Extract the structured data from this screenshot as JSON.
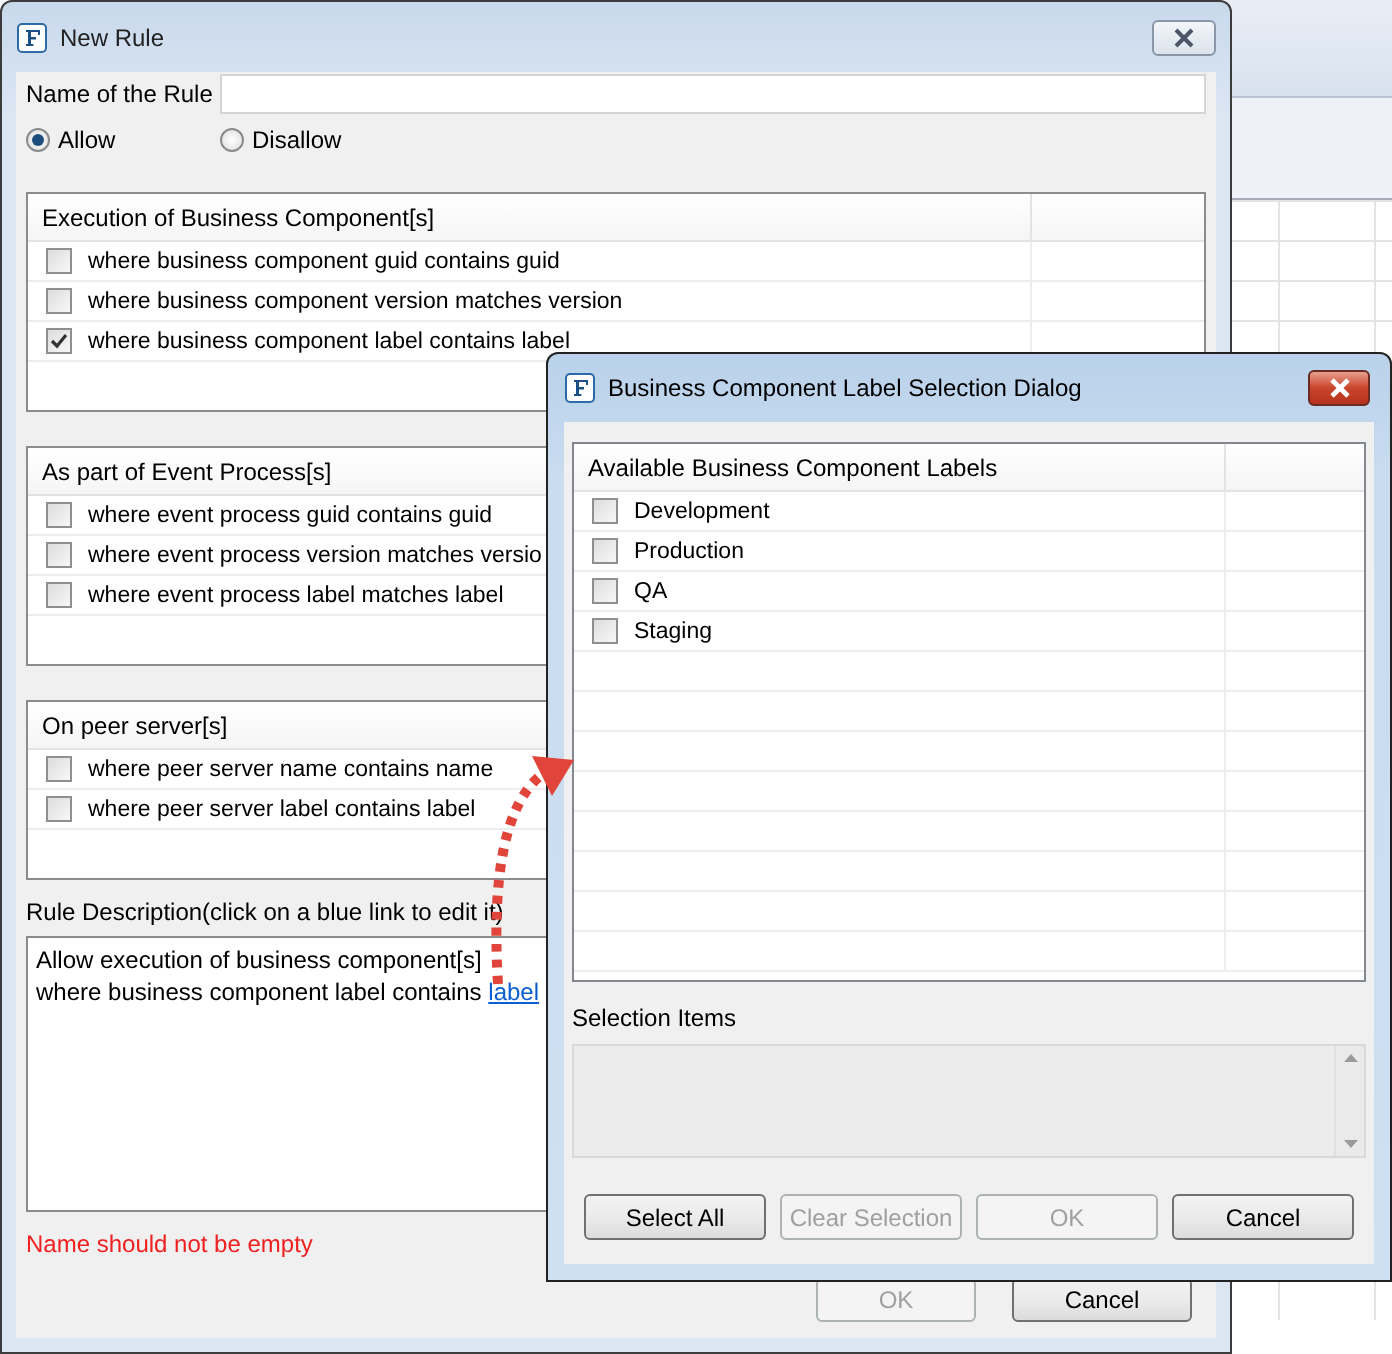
{
  "main_window": {
    "title": "New Rule",
    "name_label": "Name of the Rule",
    "radios": [
      {
        "label": "Allow",
        "selected": true
      },
      {
        "label": "Disallow",
        "selected": false
      }
    ],
    "groups": [
      {
        "title": "Execution of Business Component[s]",
        "conditions": [
          {
            "text": "where business component guid contains guid",
            "checked": false
          },
          {
            "text": "where business component version matches version",
            "checked": false
          },
          {
            "text": "where business component label contains label",
            "checked": true
          }
        ]
      },
      {
        "title": "As part of Event Process[s]",
        "conditions": [
          {
            "text": "where event process guid contains guid",
            "checked": false
          },
          {
            "text": "where event process version matches versio",
            "checked": false
          },
          {
            "text": "where event process label matches label",
            "checked": false
          }
        ]
      },
      {
        "title": "On peer server[s]",
        "conditions": [
          {
            "text": "where peer server name contains name",
            "checked": false
          },
          {
            "text": "where peer server label contains label",
            "checked": false
          }
        ]
      }
    ],
    "description": {
      "label": "Rule Description(click on a blue link to edit it)",
      "lines": [
        {
          "text": "Allow execution of business component[s]"
        },
        {
          "text": "where business component label contains",
          "link": "label"
        }
      ]
    },
    "error": "Name should not be empty",
    "buttons": [
      {
        "label": "OK",
        "disabled": true
      },
      {
        "label": "Cancel",
        "disabled": false
      }
    ]
  },
  "dialog": {
    "title": "Business Component Label Selection Dialog",
    "table": {
      "column_1": "Available Business Component Labels",
      "rows": [
        {
          "label": "Development",
          "checked": false
        },
        {
          "label": "Production",
          "checked": false
        },
        {
          "label": "QA",
          "checked": false
        },
        {
          "label": "Staging",
          "checked": false
        }
      ]
    },
    "selection_items_label": "Selection Items",
    "buttons": [
      {
        "label": "Select All",
        "disabled": false
      },
      {
        "label": "Clear Selection",
        "disabled": true
      },
      {
        "label": "OK",
        "disabled": true
      },
      {
        "label": "Cancel",
        "disabled": false
      }
    ]
  }
}
